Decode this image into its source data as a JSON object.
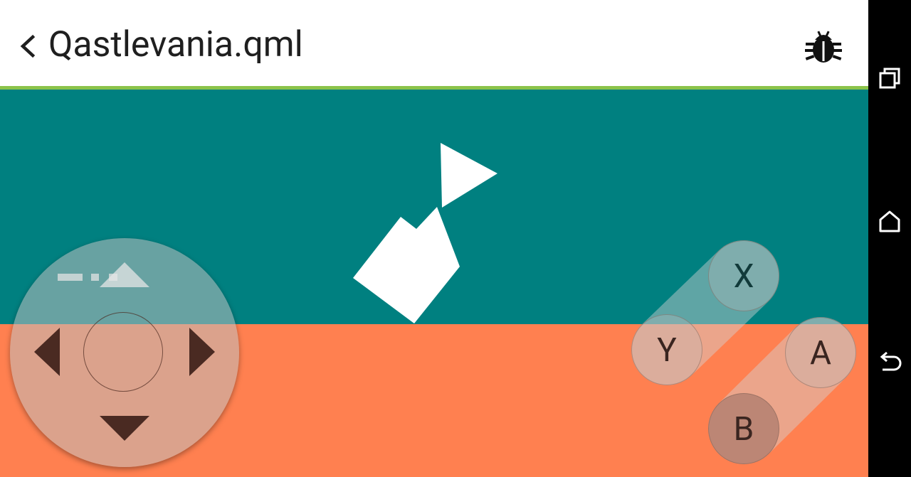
{
  "header": {
    "title": "Qastlevania.qml",
    "back_icon": "chevron-left-icon",
    "debug_icon": "bug-icon"
  },
  "colors": {
    "header_bg": "#ffffff",
    "accent_line": "#8bc34a",
    "sky": "#008080",
    "ground": "#ff8050",
    "dpad_arrow": "#4a2a22"
  },
  "controls": {
    "buttons": {
      "x": "X",
      "y": "Y",
      "a": "A",
      "b": "B"
    }
  },
  "navbar": {
    "recent_icon": "recent-apps-icon",
    "home_icon": "home-icon",
    "back_icon": "back-arrow-icon"
  }
}
